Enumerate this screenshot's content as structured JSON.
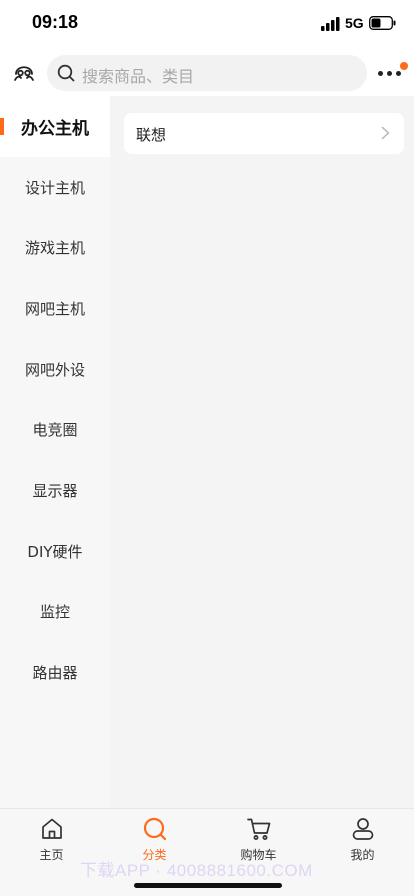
{
  "status_bar": {
    "time": "09:18",
    "network": "5G"
  },
  "search": {
    "placeholder": "搜索商品、类目"
  },
  "sidebar": {
    "items": [
      {
        "label": "办公主机",
        "active": true
      },
      {
        "label": "设计主机"
      },
      {
        "label": "游戏主机"
      },
      {
        "label": "网吧主机"
      },
      {
        "label": "网吧外设"
      },
      {
        "label": "电竞圈"
      },
      {
        "label": "显示器"
      },
      {
        "label": "DIY硬件"
      },
      {
        "label": "监控"
      },
      {
        "label": "路由器"
      }
    ]
  },
  "content": {
    "brands": [
      {
        "label": "联想"
      }
    ]
  },
  "tab_bar": {
    "tabs": [
      {
        "label": "主页",
        "icon": "home-icon"
      },
      {
        "label": "分类",
        "icon": "category-search-icon",
        "active": true
      },
      {
        "label": "购物车",
        "icon": "cart-icon"
      },
      {
        "label": "我的",
        "icon": "profile-icon"
      }
    ]
  },
  "watermark": "下载APP · 4008881600.COM",
  "colors": {
    "accent": "#ff6a1a",
    "background": "#f4f4f4",
    "sidebar": "#f7f7f7"
  }
}
